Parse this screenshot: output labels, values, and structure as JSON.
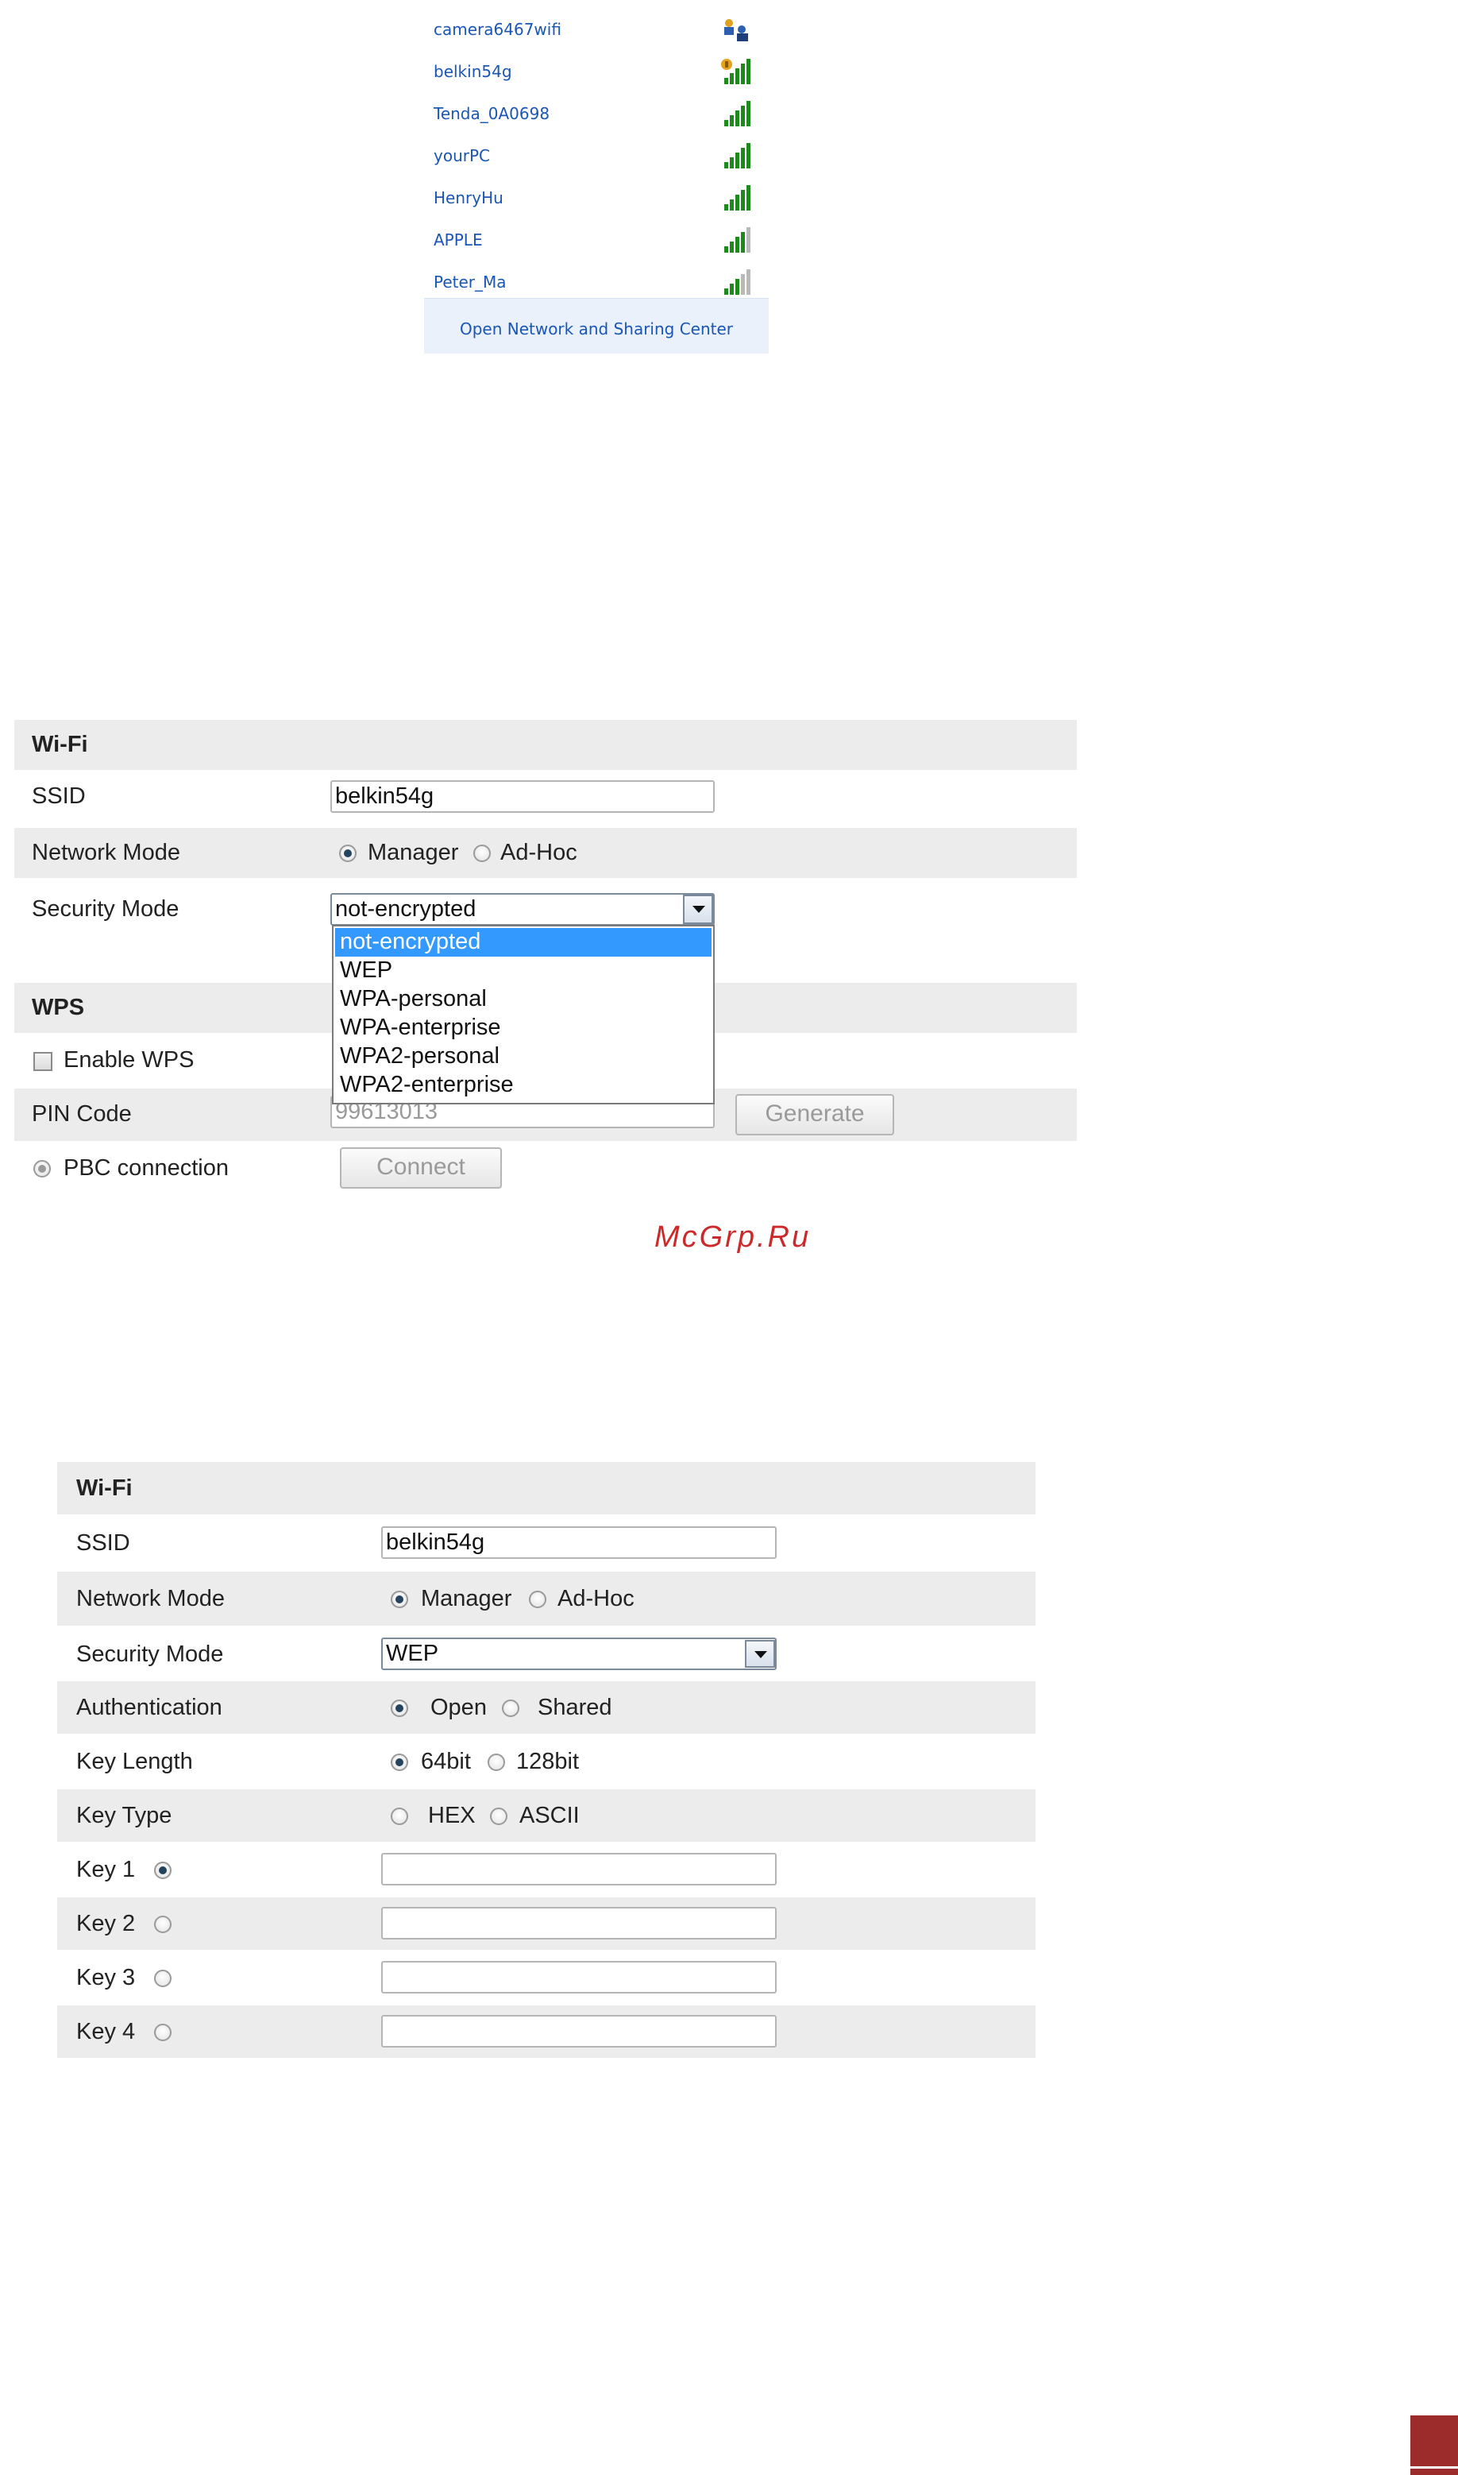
{
  "networks": {
    "items": [
      {
        "name": "camera6467wifi",
        "signal_icon": "shared-network-icon"
      },
      {
        "name": "belkin54g",
        "signal_icon": "secured-signal-icon"
      },
      {
        "name": "Tenda_0A0698",
        "signal_icon": "signal-bars-icon"
      },
      {
        "name": "yourPC",
        "signal_icon": "signal-bars-icon"
      },
      {
        "name": "HenryHu",
        "signal_icon": "signal-bars-icon"
      },
      {
        "name": "APPLE",
        "signal_icon": "signal-bars-icon"
      },
      {
        "name": "Peter_Ma",
        "signal_icon": "signal-bars-icon"
      }
    ],
    "footer_link": "Open Network and Sharing Center"
  },
  "panel1": {
    "wifi_title": "Wi-Fi",
    "ssid_label": "SSID",
    "ssid_value": "belkin54g",
    "network_mode_label": "Network Mode",
    "manager_label": "Manager",
    "adhoc_label": "Ad-Hoc",
    "security_mode_label": "Security Mode",
    "security_mode_value": "not-encrypted",
    "security_options": [
      "not-encrypted",
      "WEP",
      "WPA-personal",
      "WPA-enterprise",
      "WPA2-personal",
      "WPA2-enterprise"
    ],
    "wps_title": "WPS",
    "enable_wps_label": "Enable WPS",
    "pin_code_label": "PIN Code",
    "pin_code_value": "99613013",
    "generate_label": "Generate",
    "pbc_label": "PBC connection",
    "connect_label": "Connect"
  },
  "watermark": "McGrp.Ru",
  "panel2": {
    "wifi_title": "Wi-Fi",
    "ssid_label": "SSID",
    "ssid_value": "belkin54g",
    "network_mode_label": "Network Mode",
    "manager_label": "Manager",
    "adhoc_label": "Ad-Hoc",
    "security_mode_label": "Security Mode",
    "security_mode_value": "WEP",
    "authentication_label": "Authentication",
    "open_label": "Open",
    "shared_label": "Shared",
    "key_length_label": "Key Length",
    "bit64_label": "64bit",
    "bit128_label": "128bit",
    "key_type_label": "Key Type",
    "hex_label": "HEX",
    "ascii_label": "ASCII",
    "key1_label": "Key 1",
    "key2_label": "Key 2",
    "key3_label": "Key 3",
    "key4_label": "Key 4"
  },
  "colors": {
    "link_blue": "#1a56b5",
    "row_shade": "#ececec",
    "selection_blue": "#3399ff",
    "watermark_red": "#cc2a2a",
    "corner_red": "#9c2b2b"
  }
}
